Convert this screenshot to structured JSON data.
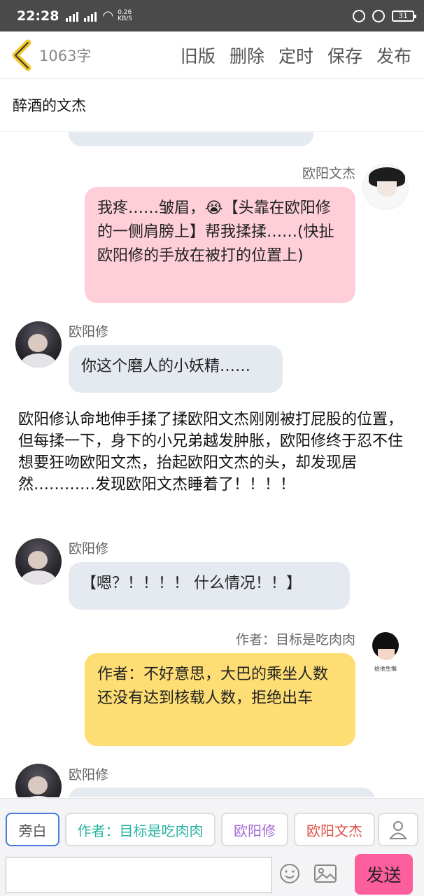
{
  "statusbar": {
    "time": "22:28",
    "net_speed_top": "0.26",
    "net_speed_bottom": "KB/S",
    "battery": "31"
  },
  "topbar": {
    "word_count": "1063字",
    "actions": [
      "旧版",
      "删除",
      "定时",
      "保存",
      "发布"
    ]
  },
  "story_title": "醉酒的文杰",
  "messages": {
    "m1": {
      "name": "欧阳文杰",
      "text": "我疼……皱眉，😭【头靠在欧阳修的一侧肩膀上】帮我揉揉……(快扯欧阳修的手放在被打的位置上)"
    },
    "m2": {
      "name": "欧阳修",
      "text": "你这个磨人的小妖精……"
    },
    "narration": "欧阳修认命地伸手揉了揉欧阳文杰刚刚被打屁股的位置，但每揉一下，身下的小兄弟越发肿胀，欧阳修终于忍不住想要狂吻欧阳文杰，抬起欧阳文杰的头，却发现居然…………发现欧阳文杰睡着了！！！！",
    "m3": {
      "name": "欧阳修",
      "text": "【嗯？！！！！ 什么情况！！】"
    },
    "m4": {
      "name": "作者：目标是吃肉肉",
      "text": "作者：不好意思，大巴的乘坐人数还没有达到核载人数，拒绝出车",
      "avatar_caption": "给他生猴"
    },
    "m5": {
      "name": "欧阳修"
    }
  },
  "roles": [
    "旁白",
    "作者：目标是吃肉肉",
    "欧阳修",
    "欧阳文杰"
  ],
  "role_colors": {
    "narrator": "#555555",
    "author": "#2bb3a3",
    "ouyangxiu": "#a36bd6",
    "wenjie": "#e0504a"
  },
  "input": {
    "value": ""
  },
  "send_label": "发送"
}
